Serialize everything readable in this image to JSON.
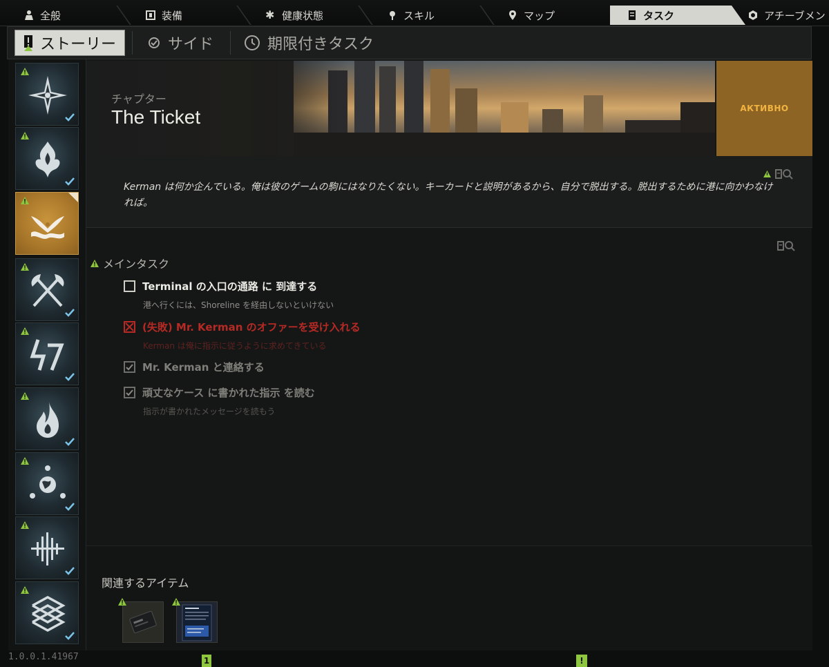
{
  "nav": {
    "tabs": [
      {
        "label": "全般",
        "icon": "person-icon"
      },
      {
        "label": "装備",
        "icon": "gear-body-icon"
      },
      {
        "label": "健康状態",
        "icon": "health-icon"
      },
      {
        "label": "スキル",
        "icon": "skill-icon"
      },
      {
        "label": "マップ",
        "icon": "map-pin-icon"
      },
      {
        "label": "タスク",
        "icon": "task-icon",
        "active": true
      },
      {
        "label": "アチーブメン",
        "icon": "achievement-icon"
      }
    ]
  },
  "subnav": {
    "tabs": [
      {
        "label": "ストーリー",
        "active": true
      },
      {
        "label": "サイド"
      },
      {
        "label": "期限付きタスク"
      }
    ]
  },
  "sidebar": {
    "chapters": [
      {
        "icon": "compass-star-icon",
        "completed": true
      },
      {
        "icon": "flame-emblem-icon",
        "completed": true
      },
      {
        "icon": "wave-bird-icon",
        "completed": false,
        "active": true
      },
      {
        "icon": "crossed-axes-icon",
        "completed": true
      },
      {
        "icon": "lightning-numbers-icon",
        "completed": true
      },
      {
        "icon": "fire-icon",
        "completed": true
      },
      {
        "icon": "globe-orbit-icon",
        "completed": true
      },
      {
        "icon": "sound-wave-icon",
        "completed": true
      },
      {
        "icon": "maze-pattern-icon",
        "completed": true
      }
    ],
    "version": "1.0.0.1.41967"
  },
  "chapter": {
    "label": "チャプター",
    "title": "The Ticket",
    "status": "АКТИВНО",
    "description": "Kerman は何か企んでいる。俺は彼のゲームの駒にはなりたくない。キーカードと説明があるから、自分で脱出する。脱出するために港に向かわなければ。"
  },
  "objectives": {
    "section_title": "メインタスク",
    "items": [
      {
        "state": "todo",
        "title": "Terminal の入口の通路 に 到達する",
        "hint": "港へ行くには、Shoreline を経由しないといけない"
      },
      {
        "state": "failed",
        "title": "(失敗) Mr. Kerman のオファーを受け入れる",
        "hint": "Kerman は俺に指示に従うように求めてきている"
      },
      {
        "state": "done",
        "title": "Mr. Kerman と連絡する",
        "hint": ""
      },
      {
        "state": "done",
        "title": "頑丈なケース に書かれた指示 を読む",
        "hint": "指示が書かれたメッセージを読もう"
      }
    ]
  },
  "related_items": {
    "title": "関連するアイテム",
    "items": [
      {
        "name": "keycard-item",
        "icon": "keycard-icon"
      },
      {
        "name": "document-item",
        "icon": "document-icon"
      }
    ]
  },
  "pager": {
    "left_label": "1",
    "right_label": "!"
  },
  "colors": {
    "accent": "#d5d5d0",
    "status_bg": "#8e6424",
    "status_text": "#f2b441",
    "failed": "#b52a24",
    "warn_green": "#8ec63f",
    "check_blue": "#7cc3e8"
  }
}
